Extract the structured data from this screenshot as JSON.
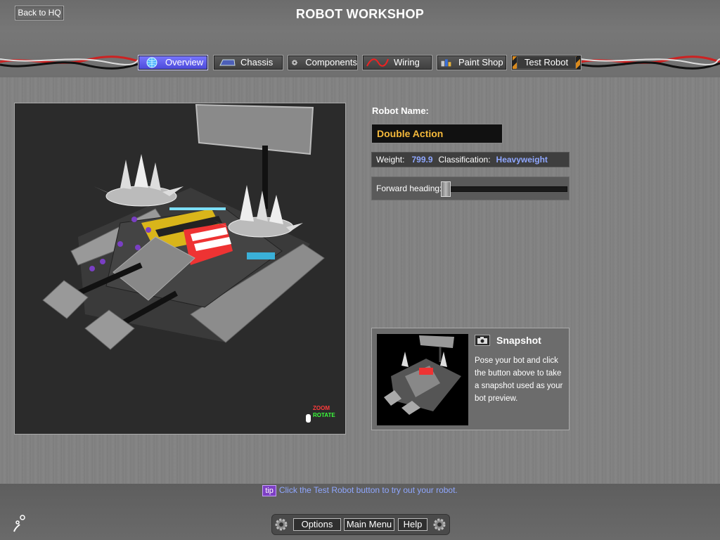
{
  "header": {
    "back_label": "Back to HQ",
    "title": "ROBOT WORKSHOP"
  },
  "tabs": [
    {
      "label": "Overview",
      "icon": "globe-icon",
      "active": true
    },
    {
      "label": "Chassis",
      "icon": "chassis-icon",
      "active": false
    },
    {
      "label": "Components",
      "icon": "gear-icon",
      "active": false
    },
    {
      "label": "Wiring",
      "icon": "wire-icon",
      "active": false
    },
    {
      "label": "Paint Shop",
      "icon": "paint-cans-icon",
      "active": false
    },
    {
      "label": "Test Robot",
      "icon": "",
      "active": false
    }
  ],
  "viewport": {
    "zoom_label": "ZOOM",
    "rotate_label": "ROTATE"
  },
  "robot": {
    "name_label": "Robot Name:",
    "name_value": "Double Action",
    "weight_label": "Weight:",
    "weight_value": "799.9",
    "class_label": "Classification:",
    "class_value": "Heavyweight",
    "heading_label": "Forward heading:",
    "heading_fraction": 0.0
  },
  "snapshot": {
    "title": "Snapshot",
    "description": "Pose your bot and click the button above to take a snapshot used as your bot preview."
  },
  "tip": {
    "badge": "tip",
    "text": "Click the Test Robot button to try out your robot."
  },
  "bottom": {
    "options_label": "Options",
    "main_menu_label": "Main Menu",
    "help_label": "Help"
  },
  "colors": {
    "active_tab": "#6664f0",
    "robot_name": "#f5b93b",
    "stat_value": "#8fa7ff",
    "tip_badge": "#7d3fc4",
    "zoom": "#ff3b3b",
    "rotate": "#3bff3b"
  }
}
